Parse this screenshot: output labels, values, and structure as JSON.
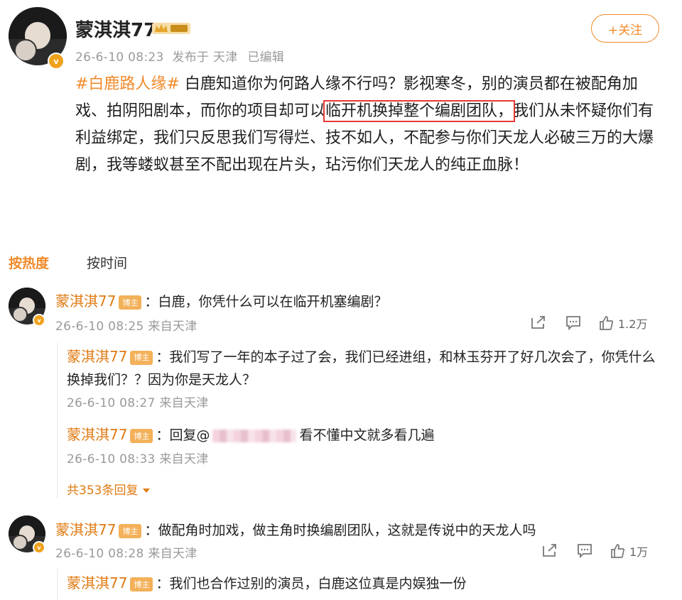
{
  "post": {
    "author": "蒙淇淇77",
    "meta_time": "26-6-10 08:23",
    "meta_from": "发布于 天津",
    "meta_edit": "已编辑",
    "follow_label": "+关注",
    "hashtag": "#白鹿路人缘#",
    "body_1": "白鹿知道你为何路人缘不行吗？影视寒冬，别的演员都在被配角加戏、拍阴阳剧本，而你的项目却可以",
    "body_highlight": "临开机换掉整个编剧团队，",
    "body_2": "我们从未怀疑你们有利益绑定，我们只反思我们写得烂、技不如人，不配参与你们天龙人必破三万的大爆剧，我等蝼蚁甚至不配出现在片头，玷污你们天龙人的纯正血脉！"
  },
  "tabs": {
    "hot": "按热度",
    "time": "按时间"
  },
  "author_tag": "博主",
  "comments": [
    {
      "name": "蒙淇淇77",
      "text": "白鹿，你凭什么可以在临开机塞编剧？",
      "time": "26-6-10 08:25 来自天津",
      "likes": "1.2万",
      "replies": [
        {
          "name": "蒙淇淇77",
          "text": "我们写了一年的本子过了会，我们已经进组，和林玉芬开了好几次会了，你凭什么换掉我们？？因为你是天龙人？",
          "time": "26-6-10 08:27 来自天津"
        },
        {
          "name": "蒙淇淇77",
          "text_prefix": "回复@",
          "text_suffix": "看不懂中文就多看几遍",
          "time": "26-6-10 08:33 来自天津"
        }
      ],
      "more": "共353条回复"
    },
    {
      "name": "蒙淇淇77",
      "text": "做配角时加戏，做主角时换编剧团队，这就是传说中的天龙人吗",
      "time": "26-6-10 08:28 来自天津",
      "likes": "1万",
      "replies": [
        {
          "name": "蒙淇淇77",
          "text": "我们也合作过别的演员，白鹿这位真是内娱独一份"
        }
      ]
    }
  ],
  "icons": [
    "share-icon",
    "comment-icon",
    "like-icon",
    "crown-badge-icon",
    "verified-icon"
  ],
  "colors": {
    "accent": "#f08a2a",
    "name": "#e07a12",
    "highlight_border": "#e53935"
  }
}
